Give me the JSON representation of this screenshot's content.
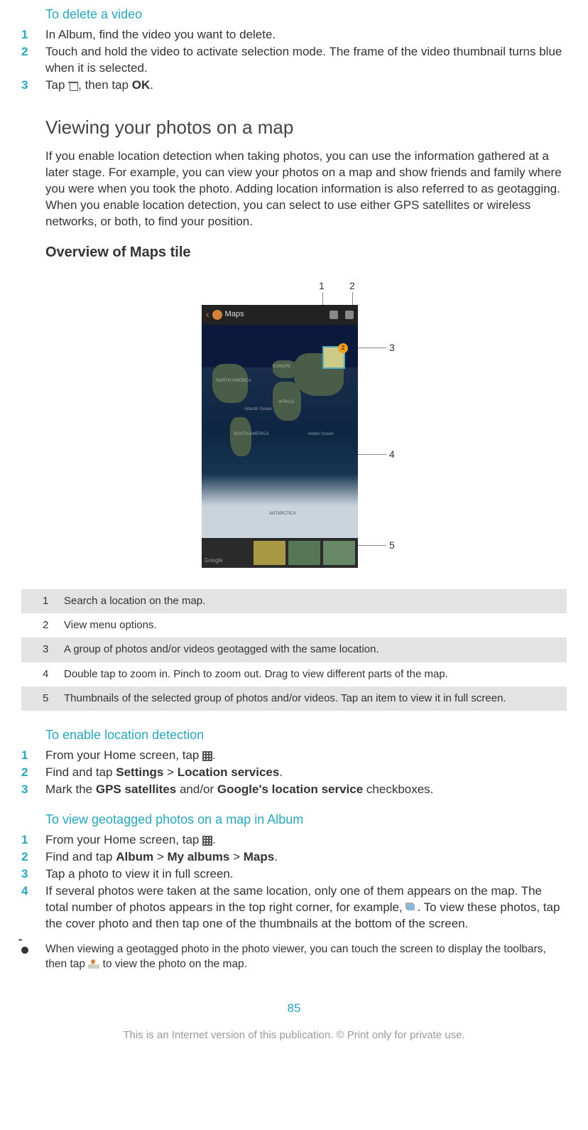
{
  "section1": {
    "title": "To delete a video",
    "steps": [
      "In Album, find the video you want to delete.",
      "Touch and hold the video to activate selection mode. The frame of the video thumbnail turns blue when it is selected.",
      {
        "pre": "Tap ",
        "post_icon": ", then tap ",
        "bold1": "OK",
        "tail": "."
      }
    ]
  },
  "heading_main": "Viewing your photos on a map",
  "intro_para": "If you enable location detection when taking photos, you can use the information gathered at a later stage. For example, you can view your photos on a map and show friends and family where you were when you took the photo. Adding location information is also referred to as geotagging. When you enable location detection, you can select to use either GPS satellites or wireless networks, or both, to find your position.",
  "heading_overview": "Overview of Maps tile",
  "figure": {
    "header_label": "Maps",
    "callouts": [
      "1",
      "2",
      "3",
      "4",
      "5"
    ],
    "geo_badge": "2",
    "map_labels": {
      "na": "NORTH AMERICA",
      "sa": "SOUTH AMERICA",
      "eu": "EUROPE",
      "af": "AFRICA",
      "ao": "Atlantic Ocean",
      "io": "Indian Ocean",
      "ant": "ANTARCTICA"
    },
    "google": "Google"
  },
  "legend": [
    {
      "n": "1",
      "t": "Search a location on the map."
    },
    {
      "n": "2",
      "t": "View menu options."
    },
    {
      "n": "3",
      "t": "A group of photos and/or videos geotagged with the same location."
    },
    {
      "n": "4",
      "t": "Double tap to zoom in. Pinch to zoom out. Drag to view different parts of the map."
    },
    {
      "n": "5",
      "t": "Thumbnails of the selected group of photos and/or videos. Tap an item to view it in full screen."
    }
  ],
  "section2": {
    "title": "To enable location detection",
    "step1_pre": "From your Home screen, tap ",
    "step1_post": ".",
    "step2_pre": "Find and tap ",
    "step2_b1": "Settings",
    "step2_sep": " > ",
    "step2_b2": "Location services",
    "step2_post": ".",
    "step3_pre": "Mark the ",
    "step3_b1": "GPS satellites",
    "step3_mid": " and/or ",
    "step3_b2": "Google's location service",
    "step3_post": " checkboxes."
  },
  "section3": {
    "title": "To view geotagged photos on a map in Album",
    "step1_pre": "From your Home screen, tap ",
    "step1_post": ".",
    "step2_pre": "Find and tap ",
    "step2_b1": "Album",
    "step2_sep": " > ",
    "step2_b2": "My albums",
    "step2_b3": "Maps",
    "step2_post": ".",
    "step3": "Tap a photo to view it in full screen.",
    "step4_pre": "If several photos were taken at the same location, only one of them appears on the map. The total number of photos appears in the top right corner, for example, ",
    "step4_post": ". To view these photos, tap the cover photo and then tap one of the thumbnails at the bottom of the screen."
  },
  "tip": {
    "pre": "When viewing a geotagged photo in the photo viewer, you can touch the screen to display the toolbars, then tap ",
    "post": " to view the photo on the map."
  },
  "page_number": "85",
  "footer": "This is an Internet version of this publication. © Print only for private use.",
  "nums": [
    "1",
    "2",
    "3",
    "4",
    "5"
  ]
}
